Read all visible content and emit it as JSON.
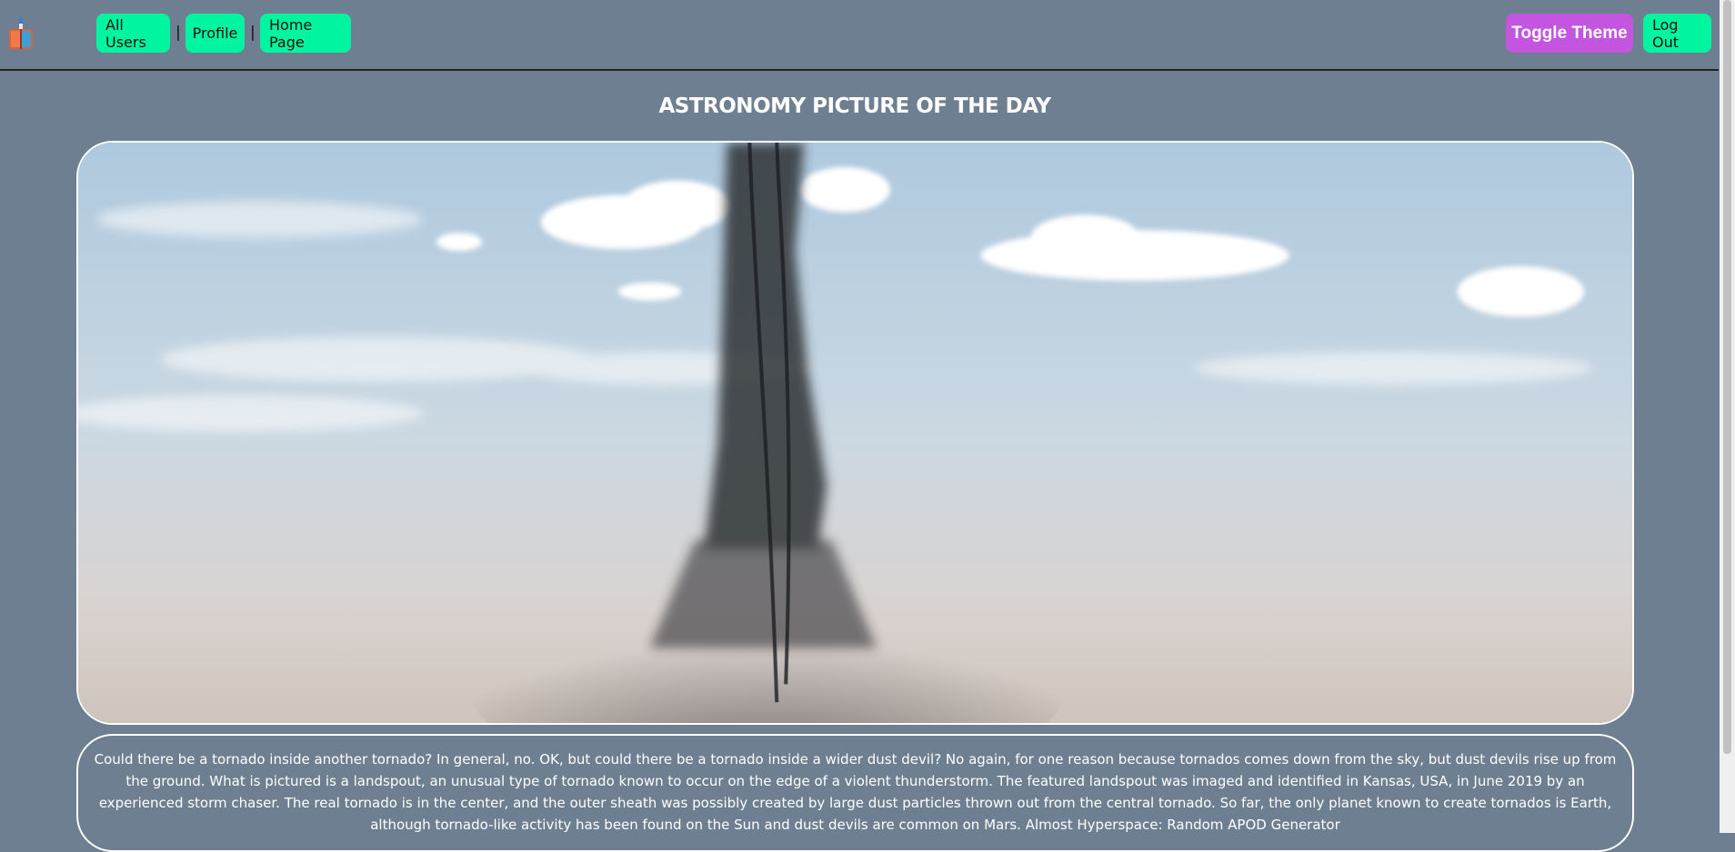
{
  "nav": {
    "all_users": "All Users",
    "separator": "|",
    "profile": "Profile",
    "home_page": "Home Page",
    "toggle_theme": "Toggle Theme",
    "log_out": "Log Out"
  },
  "page": {
    "title": "ASTRONOMY PICTURE OF THE DAY",
    "description": "Could there be a tornado inside another tornado? In general, no. OK, but could there be a tornado inside a wider dust devil? No again, for one reason because tornados comes down from the sky, but dust devils rise up from the ground. What is pictured is a landspout, an unusual type of tornado known to occur on the edge of a violent thunderstorm. The featured landspout was imaged and identified in Kansas, USA, in June 2019 by an experienced storm chaser. The real tornado is in the center, and the outer sheath was possibly created by large dust particles thrown out from the central tornado. So far, the only planet known to create tornados is Earth, although tornado-like activity has been found on the Sun and dust devils are common on Mars. Almost Hyperspace: Random APOD Generator"
  },
  "colors": {
    "background": "#6e7f91",
    "nav_button": "#00f5a0",
    "theme_button": "#c455e0"
  },
  "icons": {
    "logo": "rocket-book-logo-icon"
  }
}
